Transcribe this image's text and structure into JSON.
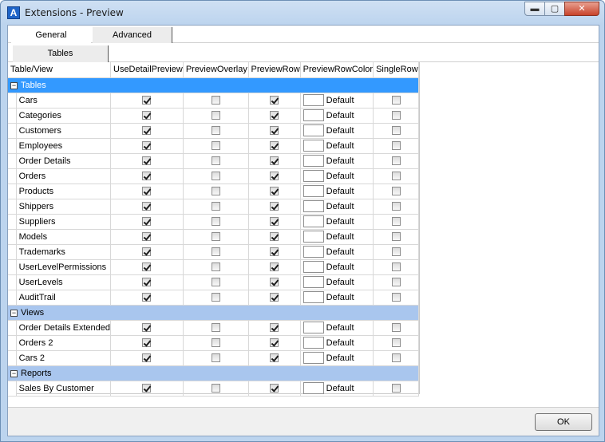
{
  "window": {
    "title": "Extensions - Preview",
    "app_icon": "A"
  },
  "tabs": [
    {
      "label": "General"
    },
    {
      "label": "Advanced"
    }
  ],
  "subtabs": [
    {
      "label": "Tables"
    }
  ],
  "columns": [
    "Table/View",
    "UseDetailPreview",
    "PreviewOverlay",
    "PreviewRow",
    "PreviewRowColor",
    "SingleRow"
  ],
  "groups": [
    {
      "name": "Tables",
      "rows": [
        {
          "name": "Cars",
          "color": "Default"
        },
        {
          "name": "Categories",
          "color": "Default"
        },
        {
          "name": "Customers",
          "color": "Default"
        },
        {
          "name": "Employees",
          "color": "Default"
        },
        {
          "name": "Order Details",
          "color": "Default"
        },
        {
          "name": "Orders",
          "color": "Default"
        },
        {
          "name": "Products",
          "color": "Default"
        },
        {
          "name": "Shippers",
          "color": "Default"
        },
        {
          "name": "Suppliers",
          "color": "Default"
        },
        {
          "name": "Models",
          "color": "Default"
        },
        {
          "name": "Trademarks",
          "color": "Default"
        },
        {
          "name": "UserLevelPermissions",
          "color": "Default"
        },
        {
          "name": "UserLevels",
          "color": "Default"
        },
        {
          "name": "AuditTrail",
          "color": "Default"
        }
      ]
    },
    {
      "name": "Views",
      "rows": [
        {
          "name": "Order Details Extended",
          "color": "Default"
        },
        {
          "name": "Orders 2",
          "color": "Default"
        },
        {
          "name": "Cars 2",
          "color": "Default"
        }
      ]
    },
    {
      "name": "Reports",
      "rows": [
        {
          "name": "Sales By Customer",
          "color": "Default"
        }
      ]
    }
  ],
  "footer": {
    "ok_label": "OK"
  },
  "icons": {
    "expander": "⊟",
    "minimize": "▬",
    "maximize": "▢",
    "close": "✕"
  }
}
